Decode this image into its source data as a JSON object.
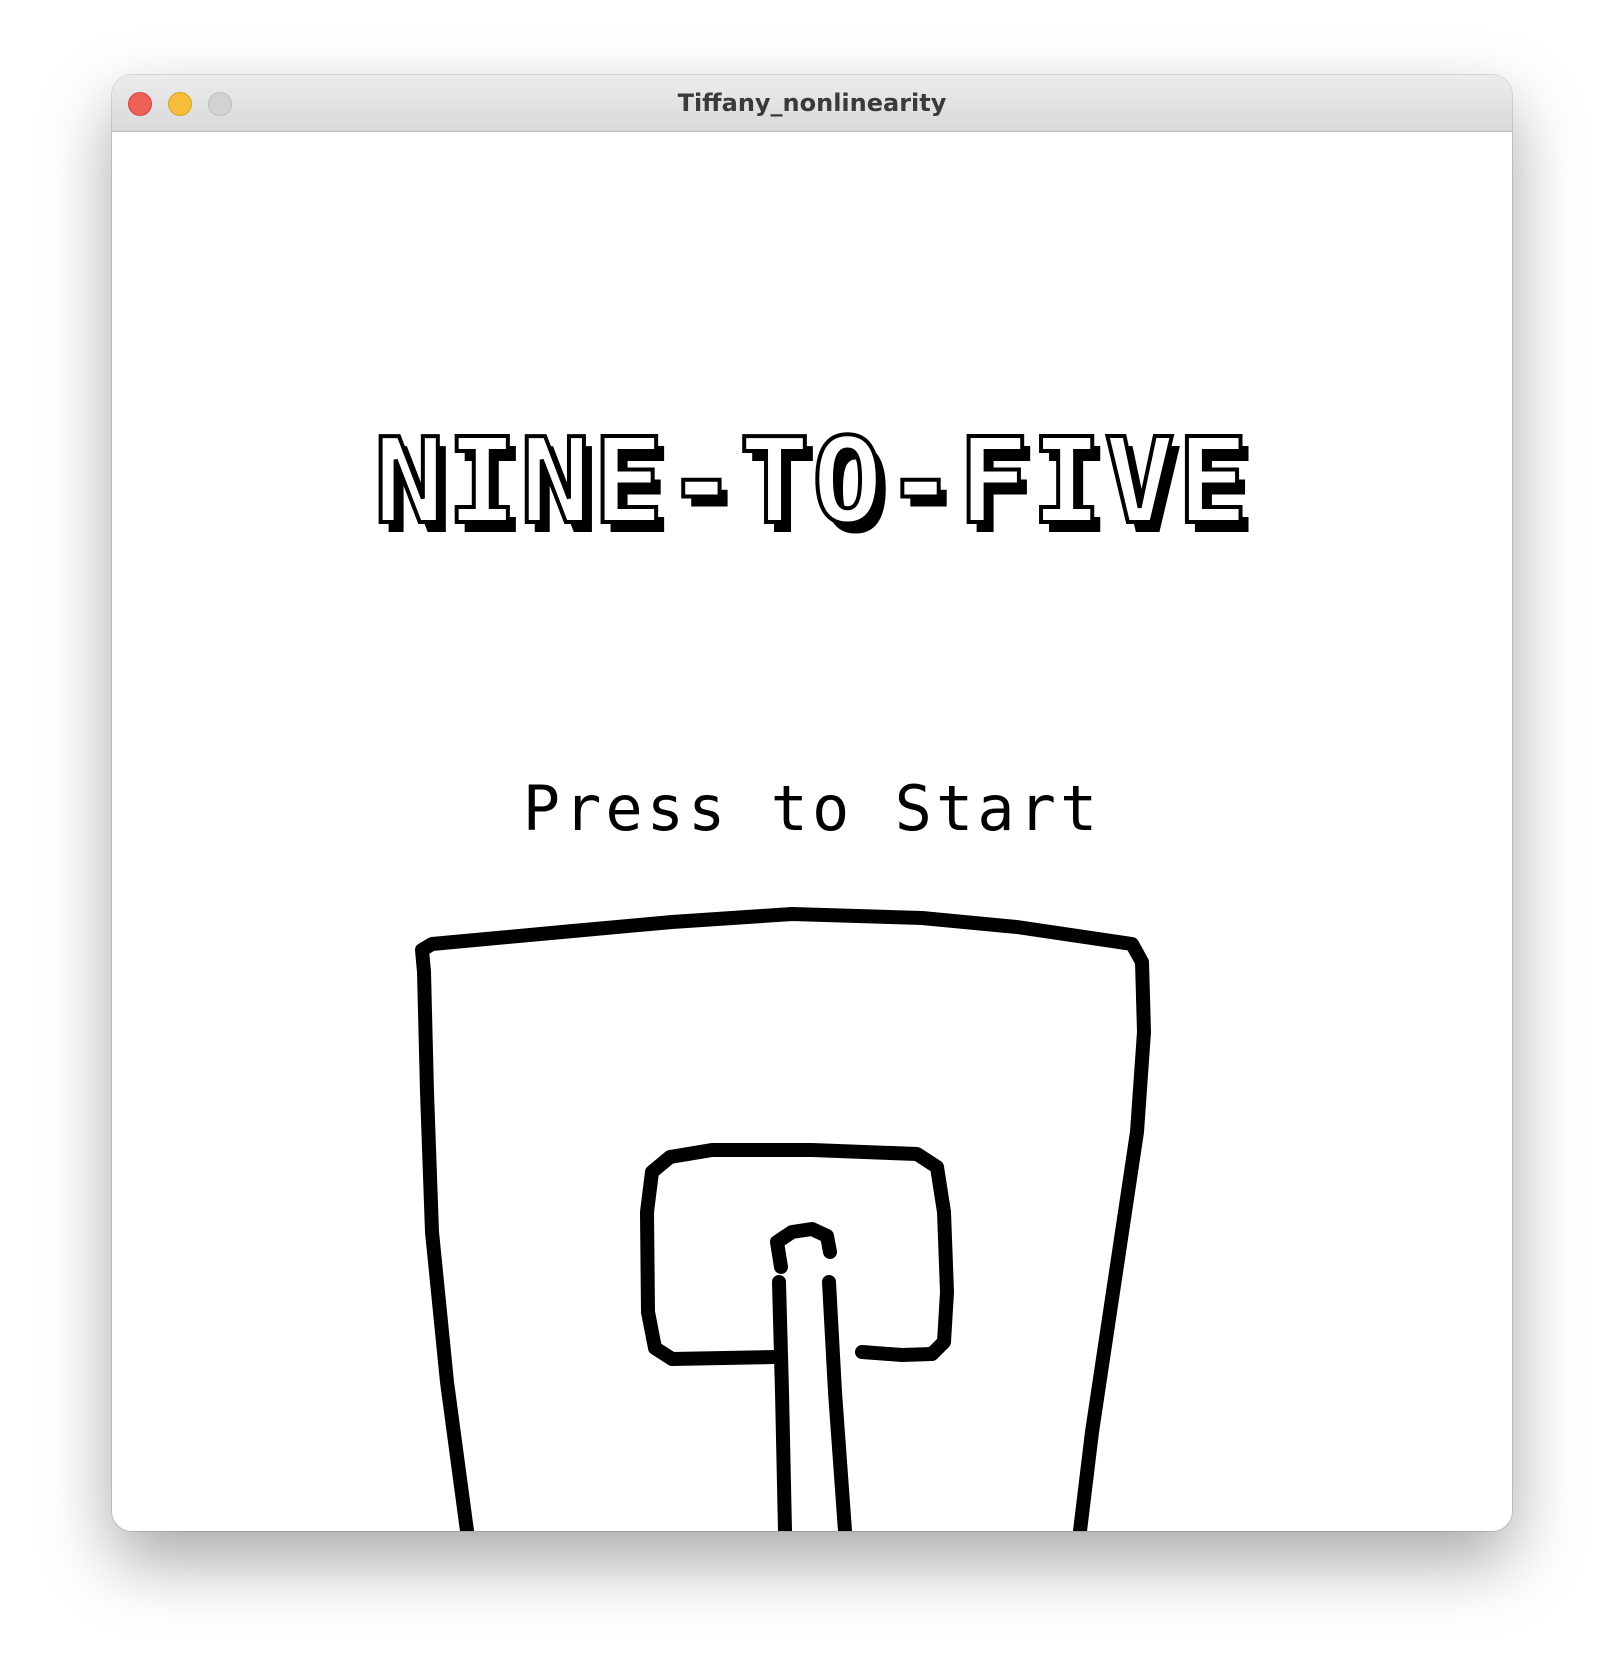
{
  "window": {
    "title": "Tiffany_nonlinearity"
  },
  "game": {
    "title": "NINE-TO-FIVE",
    "prompt": "Press to Start"
  },
  "colors": {
    "background": "#ffffff",
    "ink": "#000000",
    "close": "#ee5f57",
    "minimize": "#f5bd3b",
    "zoom": "#d3d3d3"
  }
}
